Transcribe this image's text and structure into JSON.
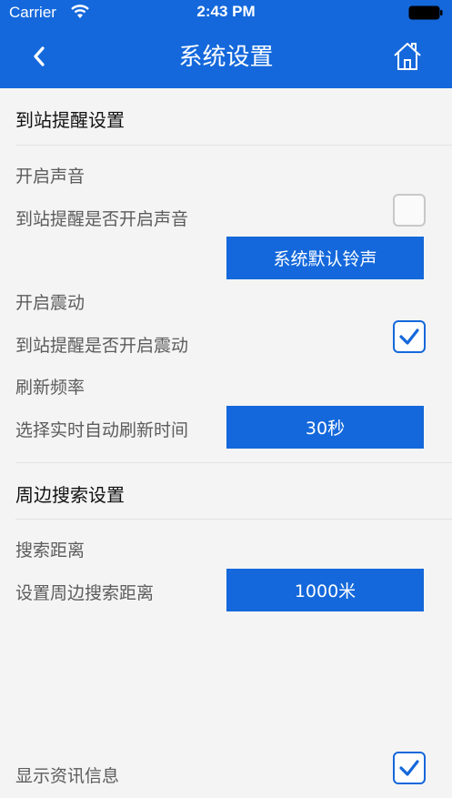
{
  "status_bar": {
    "carrier": "Carrier",
    "time": "2:43 PM"
  },
  "nav": {
    "title": "系统设置"
  },
  "arrival": {
    "section_title": "到站提醒设置",
    "sound_heading": "开启声音",
    "sound_label": "到站提醒是否开启声音",
    "sound_checked": false,
    "ringtone_button": "系统默认铃声",
    "vibrate_heading": "开启震动",
    "vibrate_label": "到站提醒是否开启震动",
    "vibrate_checked": true,
    "refresh_heading": "刷新频率",
    "refresh_label": "选择实时自动刷新时间",
    "refresh_value": "30秒"
  },
  "nearby": {
    "section_title": "周边搜索设置",
    "distance_heading": "搜索距离",
    "distance_label": "设置周边搜索距离",
    "distance_value": "1000米"
  },
  "news": {
    "label": "显示资讯信息",
    "checked": true
  },
  "colors": {
    "accent": "#1468db",
    "background": "#f4f4f4"
  }
}
